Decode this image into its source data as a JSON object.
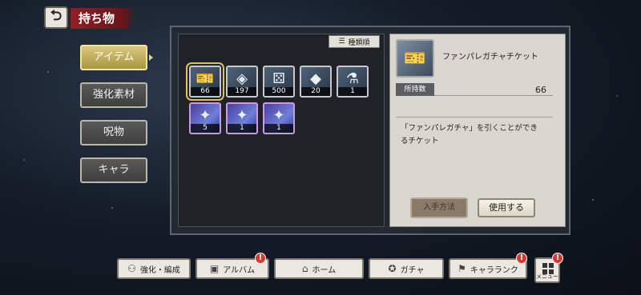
{
  "header": {
    "title": "持ち物"
  },
  "tabs": [
    {
      "label": "アイテム",
      "active": true
    },
    {
      "label": "強化素材",
      "active": false
    },
    {
      "label": "呪物",
      "active": false
    },
    {
      "label": "キャラ",
      "active": false
    }
  ],
  "sort": {
    "label": "種類順"
  },
  "items": [
    {
      "name": "ファンパレガチャチケット",
      "count": "66",
      "icon": "ticket-icon",
      "selected": true
    },
    {
      "count": "197",
      "icon": "gem-bag-icon"
    },
    {
      "count": "500",
      "icon": "dice-icon"
    },
    {
      "count": "20",
      "icon": "crystal-icon"
    },
    {
      "count": "1",
      "icon": "vial-icon"
    },
    {
      "count": "5",
      "icon": "rare-card-icon"
    },
    {
      "count": "1",
      "icon": "rare-card-icon"
    },
    {
      "count": "1",
      "icon": "rare-card-icon"
    }
  ],
  "detail": {
    "name": "ファンパレガチャチケット",
    "count_label": "所持数",
    "count": "66",
    "description_line1": "「ファンパレガチャ」を引くことができ",
    "description_line2": "るチケット",
    "obtain_label": "入手方法",
    "use_label": "使用する"
  },
  "nav": {
    "enhance": "強化・編成",
    "album": "アルバム",
    "home": "ホーム",
    "gacha": "ガチャ",
    "rank": "キャラランク",
    "menu": "メニュー",
    "badge": "!"
  },
  "colors": {
    "accent_red": "#8f1f27",
    "gold": "#d8c77e",
    "alert": "#d63a2f"
  }
}
